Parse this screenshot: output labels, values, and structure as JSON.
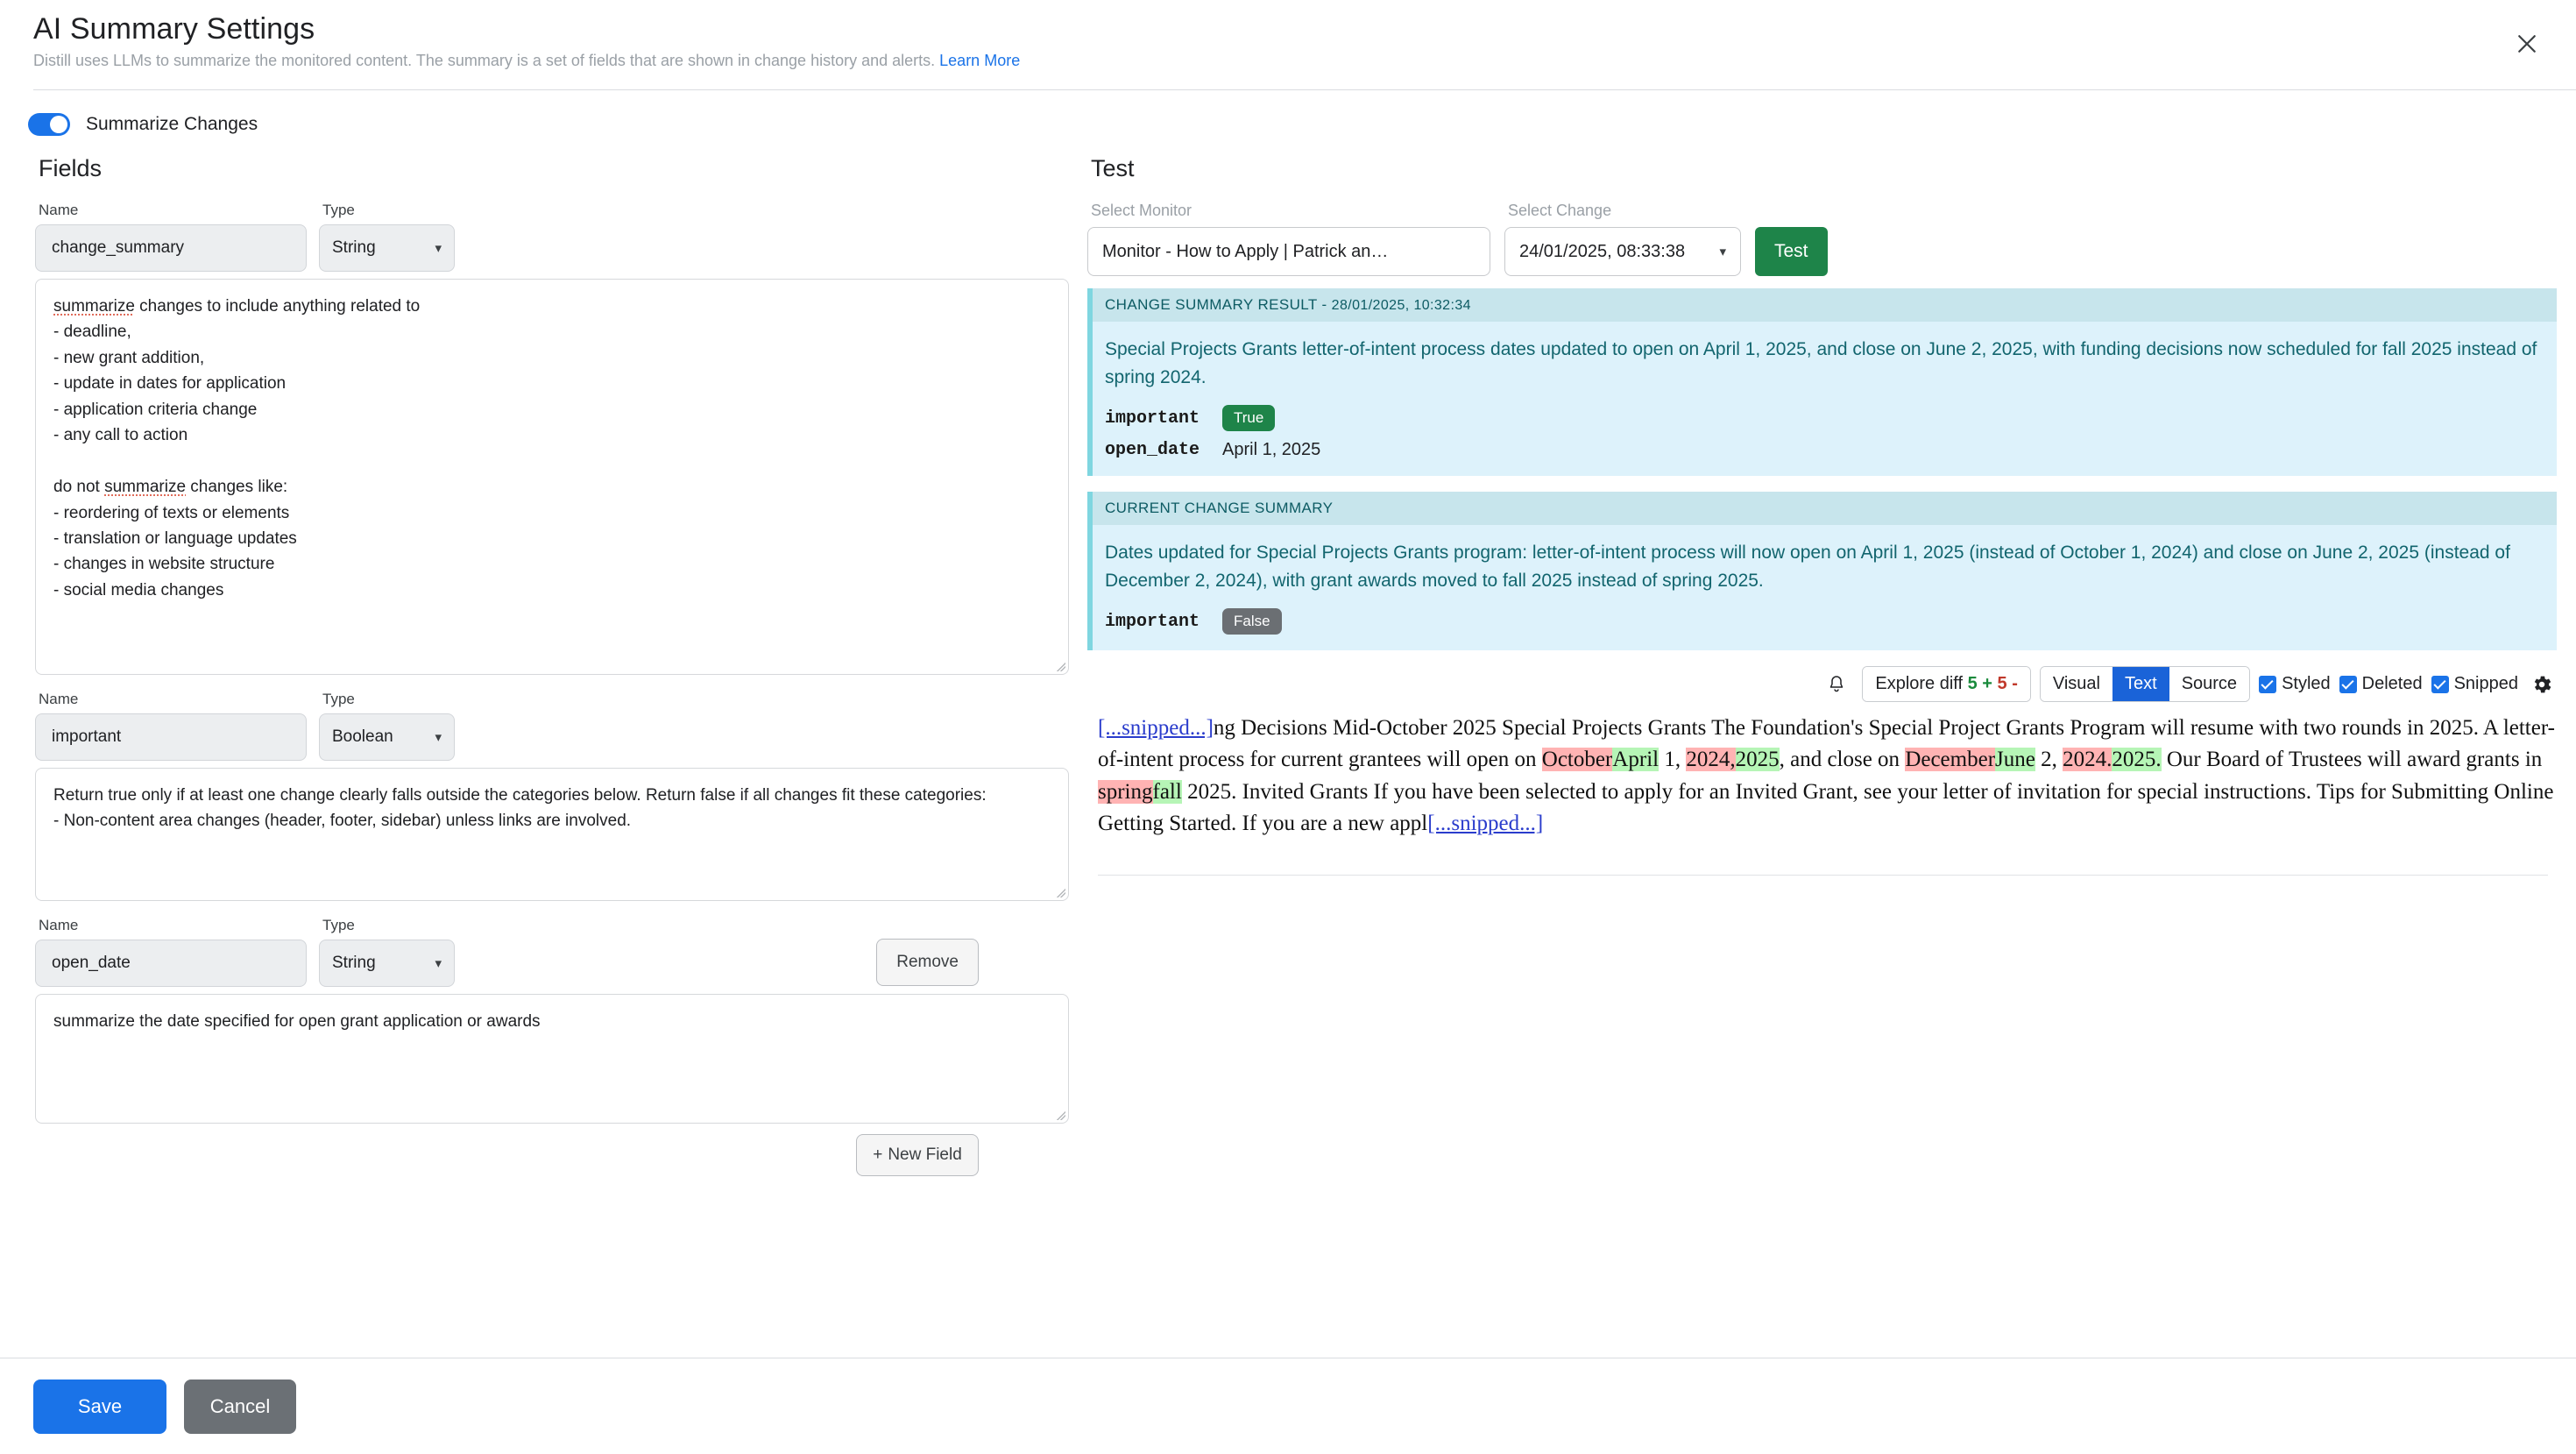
{
  "header": {
    "title": "AI Summary Settings",
    "subtitle": "Distill uses LLMs to summarize the monitored content. The summary is a set of fields that are shown in change history and alerts.",
    "learn_more": "Learn More",
    "close_icon": "close-icon"
  },
  "toggle": {
    "label": "Summarize Changes",
    "on": true,
    "accent": "#1a73e8"
  },
  "fields_panel": {
    "heading": "Fields",
    "name_label": "Name",
    "type_label": "Type",
    "remove_label": "Remove",
    "new_field_label": "New Field",
    "fields": [
      {
        "name": "change_summary",
        "type": "String",
        "prompt_line_1": "summarize",
        "prompt_rest_1": " changes to include anything related to",
        "prompt_lines": [
          "- deadline,",
          "- new grant addition,",
          "- update in dates for application",
          "- application criteria change",
          "- any call to action",
          "",
          "do not ",
          "- reordering of texts or elements",
          "- translation or language updates",
          "- changes in website structure",
          "- social media changes"
        ],
        "prompt_mid_word": "summarize",
        "prompt_mid_tail": " changes like:"
      },
      {
        "name": "important",
        "type": "Boolean",
        "prompt": "Return true only if at least one change clearly falls outside the categories below. Return false if all changes fit these categories:\n- Non-content area changes (header, footer, sidebar) unless links are involved."
      },
      {
        "name": "open_date",
        "type": "String",
        "prompt": "summarize the date specified for open grant application or awards"
      }
    ]
  },
  "test_panel": {
    "heading": "Test",
    "monitor_label": "Select Monitor",
    "monitor_value": "Monitor - How to Apply | Patrick an…",
    "change_label": "Select Change",
    "change_value": "24/01/2025, 08:33:38",
    "test_button": "Test",
    "results": [
      {
        "head_title": "CHANGE SUMMARY RESULT -",
        "head_ts": "28/01/2025, 10:32:34",
        "text": "Special Projects Grants letter-of-intent process dates updated to open on April 1, 2025, and close on June 2, 2025, with funding decisions now scheduled for fall 2025 instead of spring 2024.",
        "rows": [
          {
            "key": "important",
            "badge": "True",
            "badge_kind": "true"
          },
          {
            "key": "open_date",
            "value": "April 1, 2025"
          }
        ]
      },
      {
        "head_title": "CURRENT CHANGE SUMMARY",
        "head_ts": "",
        "text": "Dates updated for Special Projects Grants program: letter-of-intent process will now open on April 1, 2025 (instead of October 1, 2024) and close on June 2, 2025 (instead of December 2, 2024), with grant awards moved to fall 2025 instead of spring 2025.",
        "rows": [
          {
            "key": "important",
            "badge": "False",
            "badge_kind": "false"
          }
        ]
      }
    ]
  },
  "diff_toolbar": {
    "bell_icon": "bell-icon",
    "explore_label": "Explore diff",
    "added_count": "5 +",
    "removed_count": "5 -",
    "views": [
      {
        "label": "Visual",
        "active": false
      },
      {
        "label": "Text",
        "active": true
      },
      {
        "label": "Source",
        "active": false
      }
    ],
    "checkboxes": [
      {
        "label": "Styled",
        "checked": true
      },
      {
        "label": "Deleted",
        "checked": true
      },
      {
        "label": "Snipped",
        "checked": true
      }
    ],
    "gear_icon": "gear-icon"
  },
  "diff_text": {
    "snip_open": "[...snipped...]",
    "seg_1": "ng Decisions Mid-October 2025 Special Projects Grants The Foundation's Special Project Grants Program will resume with two rounds in 2025. A letter-of-intent process for current grantees will open on ",
    "del_1": "October",
    "ins_1": "April",
    "seg_2": " 1, ",
    "del_2": "2024,",
    "ins_2": "2025",
    "seg_3": ", and close on ",
    "del_3": "December",
    "ins_3": "June",
    "seg_4": " 2, ",
    "del_4": "2024.",
    "ins_4": "2025.",
    "seg_5": " Our Board of Trustees will award grants in ",
    "del_5": "spring",
    "ins_5": "fall",
    "seg_6": " 2025. Invited Grants If you have been selected to apply for an Invited Grant, see your letter of invitation for special instructions. Tips for Submitting Online Getting Started. If you are a new appl",
    "snip_close": "[...snipped...]"
  },
  "footer": {
    "save_label": "Save",
    "cancel_label": "Cancel"
  }
}
